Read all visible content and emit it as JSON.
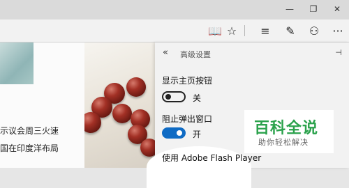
{
  "window": {
    "minimize": "—",
    "restore": "❐",
    "close": "✕"
  },
  "toolbar": {
    "reading_view": "📖",
    "favorite": "☆",
    "hub": "≡",
    "notes": "✎",
    "share": "⚇",
    "more": "···"
  },
  "content": {
    "headline_1": "示议会周三火速",
    "headline_2": "国在印度洋布局"
  },
  "panel": {
    "back": "«",
    "title": "高级设置",
    "pin": "⊣",
    "settings": [
      {
        "label": "显示主页按钮",
        "state": "关",
        "on": false
      },
      {
        "label": "阻止弹出窗口",
        "state": "开",
        "on": true
      },
      {
        "label": "使用 Adobe Flash Player"
      }
    ]
  },
  "watermark": {
    "main": "百科全说",
    "sub": "助你轻松解决"
  },
  "colors": {
    "toggle_on": "#0f6bc4",
    "watermark_green": "#2ba24c"
  }
}
